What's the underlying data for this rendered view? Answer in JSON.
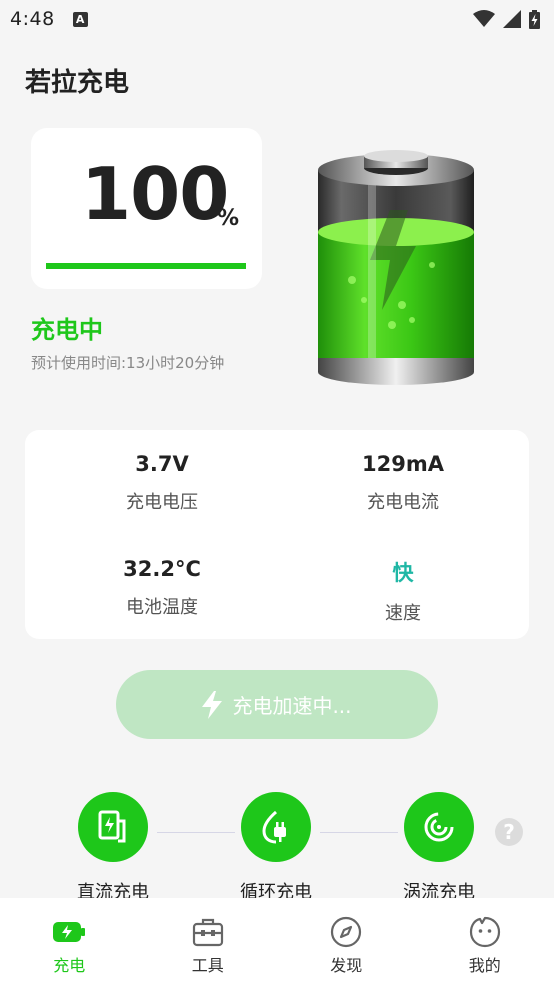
{
  "status_bar": {
    "time": "4:48",
    "notification_letter": "A"
  },
  "app": {
    "title": "若拉充电"
  },
  "battery": {
    "level": "100",
    "level_fraction": 1.0,
    "unit": "%",
    "state": "充电中",
    "estimate": "预计使用时间:13小时20分钟"
  },
  "stats": [
    {
      "value": "3.7V",
      "label": "充电电压"
    },
    {
      "value": "129mA",
      "label": "充电电流"
    },
    {
      "value": "32.2°C",
      "label": "电池温度"
    },
    {
      "value": "快",
      "label": "速度"
    }
  ],
  "boost": {
    "label": "充电加速中..."
  },
  "modes": [
    {
      "label": "直流充电",
      "icon": "dc-charge-icon"
    },
    {
      "label": "循环充电",
      "icon": "cycle-charge-icon"
    },
    {
      "label": "涡流充电",
      "icon": "vortex-charge-icon"
    }
  ],
  "help": {
    "glyph": "?"
  },
  "nav": [
    {
      "label": "充电",
      "icon": "battery-charge-icon",
      "active": true
    },
    {
      "label": "工具",
      "icon": "toolbox-icon",
      "active": false
    },
    {
      "label": "发现",
      "icon": "compass-icon",
      "active": false
    },
    {
      "label": "我的",
      "icon": "profile-face-icon",
      "active": false
    }
  ],
  "colors": {
    "accent": "#1ec71a",
    "fast": "#1fb7a5",
    "boost_bg": "#bfe6c3",
    "background": "#f5f5f5"
  }
}
